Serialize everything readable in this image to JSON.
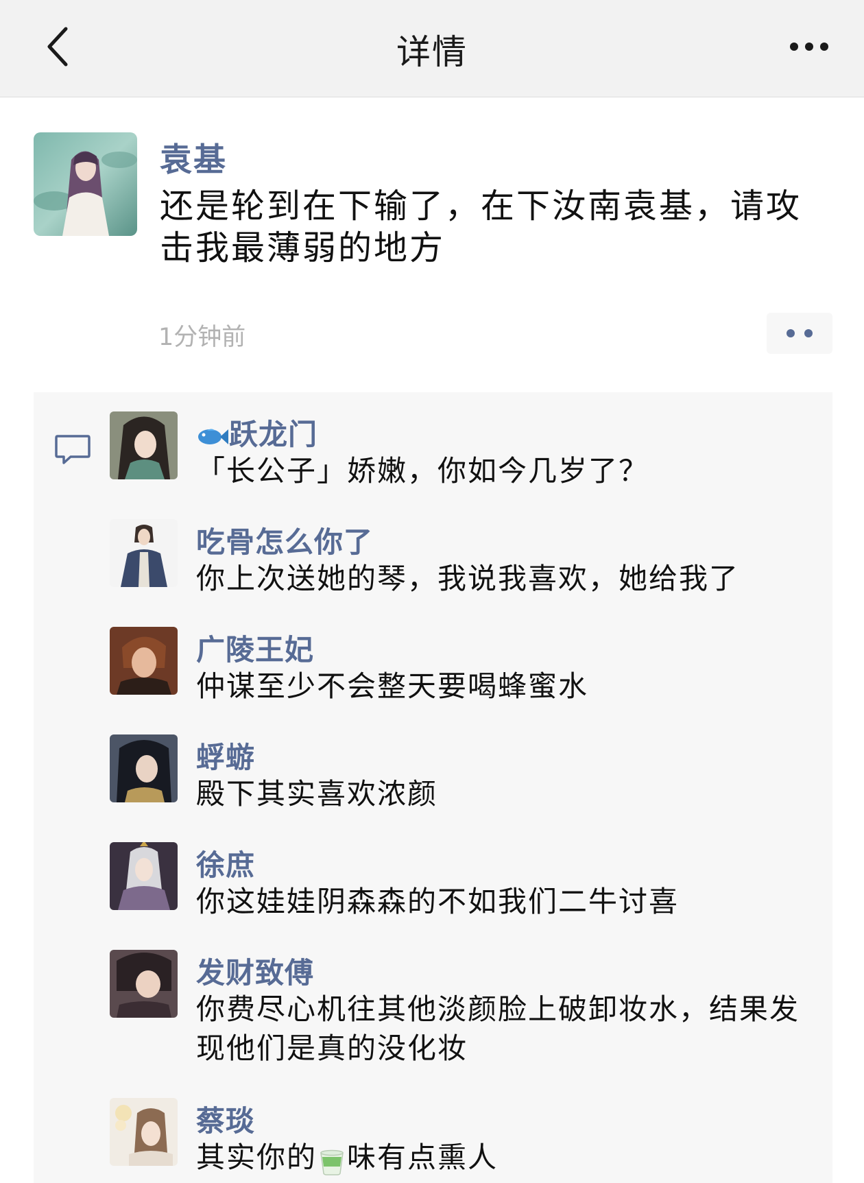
{
  "navbar": {
    "title": "详情",
    "back_icon": "chevron-left-icon",
    "more_icon": "more-horizontal-icon"
  },
  "post": {
    "author": "袁基",
    "text": "还是轮到在下输了，在下汝南袁基，请攻击我最薄弱的地方",
    "time": "1分钟前",
    "action_icon": "two-dots-icon"
  },
  "comments": [
    {
      "name_icon": "fish-icon",
      "name": "跃龙门",
      "text": "「长公子」娇嫩，你如今几岁了？"
    },
    {
      "name": "吃骨怎么你了",
      "text": "你上次送她的琴，我说我喜欢，她给我了"
    },
    {
      "name": "广陵王妃",
      "text": "仲谋至少不会整天要喝蜂蜜水"
    },
    {
      "name": "蜉蝣",
      "text": "殿下其实喜欢浓颜"
    },
    {
      "name": "徐庶",
      "text": "你这娃娃阴森森的不如我们二牛讨喜"
    },
    {
      "name": "发财致傅",
      "text": "你费尽心机往其他淡颜脸上破卸妆水，结果发现他们是真的没化妆"
    },
    {
      "name": "蔡琰",
      "text_before": "其实你的",
      "text_icon": "tea-cup-icon",
      "text_after": "味有点熏人"
    }
  ],
  "colors": {
    "link": "#576b95",
    "navbar_bg": "#f2f2f2",
    "comments_bg": "#f7f7f7",
    "time": "#b2b2b2"
  }
}
